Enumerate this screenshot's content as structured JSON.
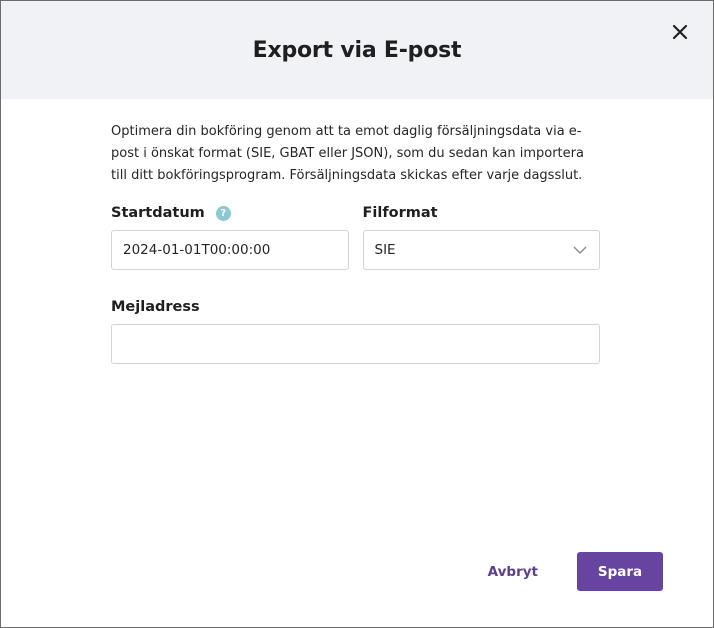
{
  "dialog": {
    "title": "Export via E-post",
    "description": "Optimera din bokföring genom att ta emot daglig försäljningsdata via e-post i önskat format (SIE, GBAT eller JSON), som du sedan kan importera till ditt bokföringsprogram. Försäljningsdata skickas efter varje dagsslut."
  },
  "form": {
    "start_date": {
      "label": "Startdatum",
      "value": "2024-01-01T00:00:00",
      "help_glyph": "?"
    },
    "file_format": {
      "label": "Filformat",
      "selected": "SIE"
    },
    "email": {
      "label": "Mejladress",
      "value": ""
    }
  },
  "footer": {
    "cancel_label": "Avbryt",
    "save_label": "Spara"
  },
  "colors": {
    "accent": "#67449f",
    "accent_text": "#5b3e95",
    "header_bg": "#f1f2f5",
    "help_icon": "#8cc8d3"
  },
  "icons": {
    "close": "close-icon",
    "help": "help-icon",
    "dropdown": "chevron-down-icon"
  }
}
